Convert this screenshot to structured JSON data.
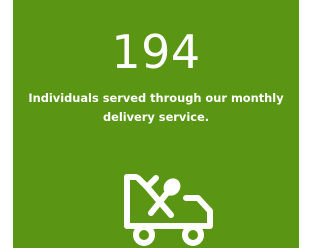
{
  "stat": {
    "value": "194",
    "caption": "Individuals served through our monthly delivery service."
  },
  "icon": {
    "name": "meal-delivery-truck-icon"
  },
  "colors": {
    "card_background": "#5a9614",
    "foreground": "#ffffff",
    "page_background": "#ffffff"
  }
}
